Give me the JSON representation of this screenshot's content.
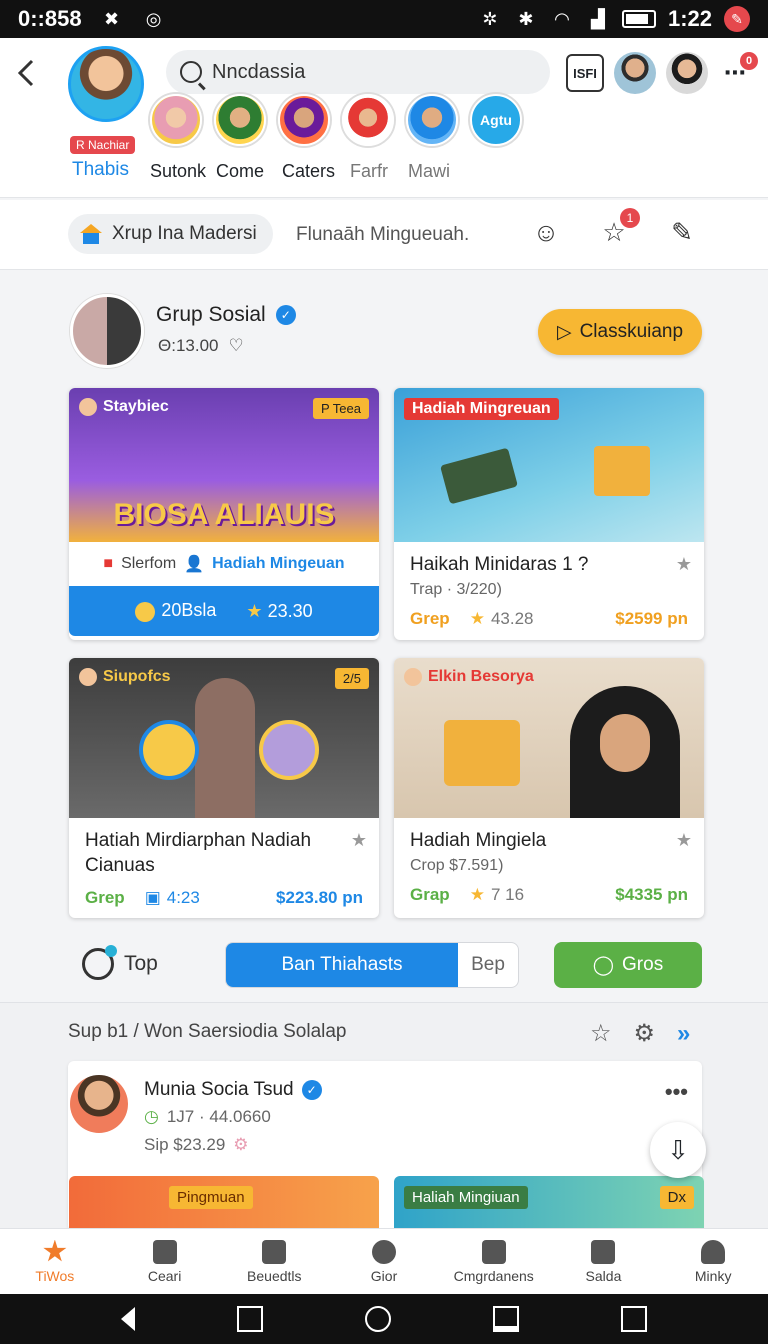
{
  "status_bar": {
    "time_left": "0::858",
    "time_right": "1:22"
  },
  "header": {
    "search_value": "Nncdassia",
    "calendar_label": "ISFI",
    "notif_count": "0",
    "me": {
      "tag": "R Nachiar",
      "name": "Thabis"
    },
    "stories": [
      "Sutonk",
      "Come",
      "Caters",
      "Farfr",
      "Mawi"
    ],
    "story_extra_label": "Agtu"
  },
  "subrow": {
    "chip_label": "Xrup Ina Madersi",
    "subtitle": "Flunaāh Mingueuah.",
    "star_badge": "1"
  },
  "group": {
    "name": "Grup Sosial",
    "time": "Θ:13.00",
    "cta_label": "Classkuianp"
  },
  "cards": [
    {
      "img_label": "Staybiec",
      "img_tag": "P Teea",
      "art_text": "BIOSA ALIAUIS",
      "row_left": "Slerfom",
      "row_right": "Hadiah Mingeuan",
      "bar_left": "20Bsla",
      "bar_right": "23.30"
    },
    {
      "img_label": "Hadiah Mingreuan",
      "title": "Haikah Minidaras 1 ?",
      "sub": "Trap · 3/220)",
      "grep": "Grep",
      "rating": "43.28",
      "price": "$2599 pn"
    },
    {
      "img_label": "Siupofcs",
      "img_tag": "2/5",
      "title": "Hatiah Mirdiarphan Nadiah Cianuas",
      "grep": "Grep",
      "rating": "4:23",
      "price": "$223.80 pn"
    },
    {
      "img_label": "Elkin Besorya",
      "title": "Hadiah Mingiela",
      "sub": "Crop  $7.591)",
      "grep": "Grap",
      "rating": "7  16",
      "price": "$4335 pn"
    }
  ],
  "actions": {
    "top_label": "Top",
    "primary_label": "Ban Thiahasts",
    "secondary_label": "Bep",
    "green_label": "Gros"
  },
  "section2": {
    "title": "Sup b1 / Won Saersiodia Solalap",
    "post": {
      "name": "Munia Socia Tsud",
      "meta1": "1J7 · 44.0660",
      "meta2": "Sip  $23.29"
    },
    "mini_cards": [
      "Pingmuan",
      "Haliah Mingiuan"
    ],
    "mini_tag": "Dx"
  },
  "tabs": [
    "TiWos",
    "Ceari",
    "Beuedtls",
    "Gior",
    "Cmgrdanens",
    "Salda",
    "Minky"
  ],
  "colors": {
    "accent_blue": "#1e88e5",
    "accent_orange": "#f7b733",
    "accent_green": "#5bb046",
    "badge_red": "#e5484d"
  }
}
